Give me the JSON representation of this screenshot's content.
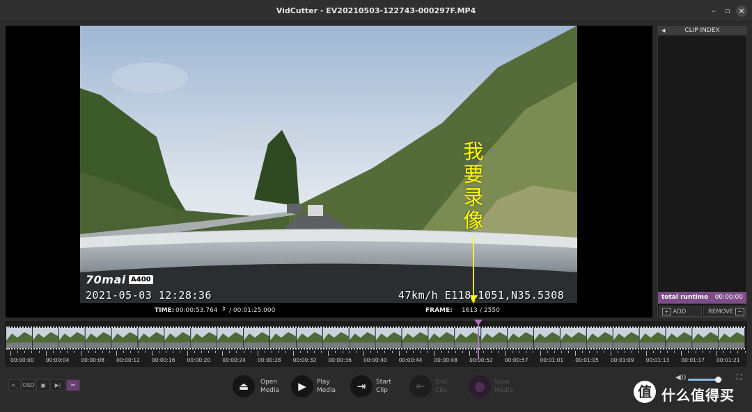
{
  "window": {
    "title": "VidCutter - EV20210503-122743-000297F.MP4",
    "minimize": "–",
    "maximize": "▫",
    "close": "×"
  },
  "video_osd": {
    "brand": "70mai",
    "model": "A400",
    "datetime": "2021-05-03  12:28:36",
    "gps": "47km/h E118.1051,N35.5308"
  },
  "annotation": {
    "text": "我要录像",
    "arrow_color": "#ffff00"
  },
  "info": {
    "time_label": "TIME:",
    "time_current": "00:00:53.764",
    "time_total": "/ 00:01:25.000",
    "frame_label": "FRAME:",
    "frame_current": "1613",
    "frame_total": "/  2550"
  },
  "clip_index": {
    "header": "CLIP INDEX",
    "runtime_label": "total runtime",
    "runtime_value": "00:00:00",
    "add_label": "ADD",
    "remove_label": "REMOVE"
  },
  "timeline": {
    "ticks": [
      "00:00:00",
      "00:00:04",
      "00:00:08",
      "00:00:12",
      "00:00:16",
      "00:00:20",
      "00:00:24",
      "00:00:28",
      "00:00:32",
      "00:00:36",
      "00:00:40",
      "00:00:44",
      "00:00:48",
      "00:00:52",
      "00:00:57",
      "00:01:01",
      "00:01:05",
      "00:01:09",
      "00:01:13",
      "00:01:17",
      "00:01:21"
    ],
    "playhead_fraction": 0.6325
  },
  "tools": {
    "console": ">_",
    "osd": "OSD",
    "screenshot": "▣",
    "skip": "▶|",
    "cut": "✂"
  },
  "controls": {
    "open_line1": "Open",
    "open_line2": "Media",
    "play_line1": "Play",
    "play_line2": "Media",
    "start_line1": "Start",
    "start_line2": "Clip",
    "end_line1": "End",
    "end_line2": "Clip",
    "save_line1": "Save",
    "save_line2": "Media"
  },
  "volume": {
    "level": 0.85
  },
  "watermark": {
    "text": "什么值得买",
    "logo": "值"
  },
  "colors": {
    "accent": "#7d4d88",
    "playhead": "#b06fbd"
  }
}
